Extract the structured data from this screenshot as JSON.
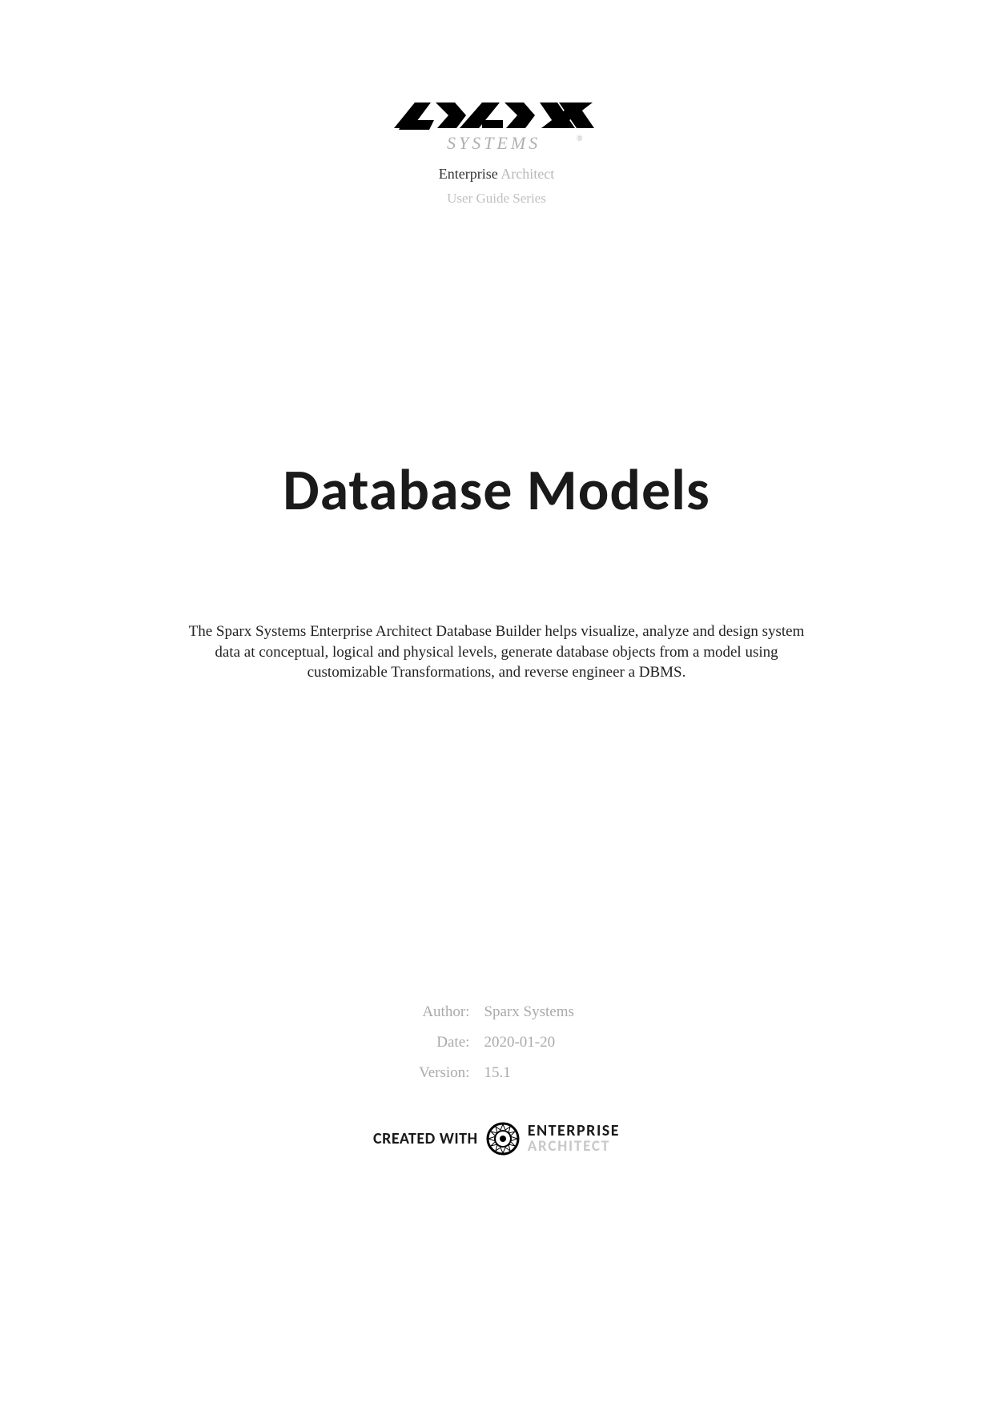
{
  "logo": {
    "company_top": "SPARX",
    "company_bottom": "SYSTEMS"
  },
  "header": {
    "product_strong": "Enterprise",
    "product_light": "Architect",
    "series": "User Guide Series"
  },
  "title": "Database Models",
  "description": "The Sparx Systems Enterprise Architect Database Builder helps visualize, analyze and design system data at conceptual, logical and physical levels, generate database objects from a model using customizable Transformations, and reverse engineer a DBMS.",
  "meta": {
    "author_label": "Author:",
    "author_value": "Sparx Systems",
    "date_label": "Date:",
    "date_value": "2020-01-20",
    "version_label": "Version:",
    "version_value": "15.1"
  },
  "footer": {
    "created_with": "CREATED WITH",
    "badge_top": "ENTERPRISE",
    "badge_bottom": "ARCHITECT"
  }
}
